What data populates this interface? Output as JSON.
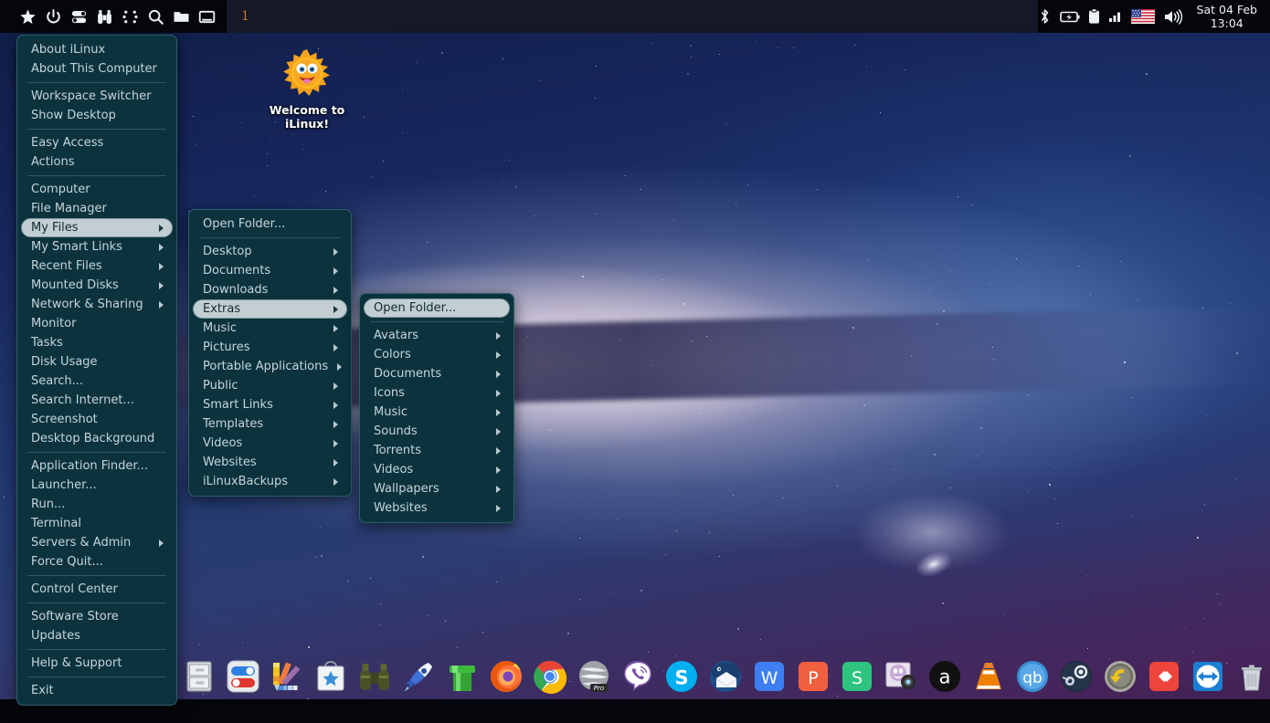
{
  "panel": {
    "launchers": [
      {
        "name": "favorites-star-icon",
        "label": "Favorites"
      },
      {
        "name": "power-icon",
        "label": "Power"
      },
      {
        "name": "toggles-icon",
        "label": "Settings Toggles"
      },
      {
        "name": "binoculars-icon",
        "label": "Find"
      },
      {
        "name": "app-grid-icon",
        "label": "Applications"
      },
      {
        "name": "search-icon",
        "label": "Search"
      },
      {
        "name": "folder-icon",
        "label": "File Manager"
      },
      {
        "name": "show-desktop-icon",
        "label": "Show Desktop"
      }
    ],
    "workspace": "1",
    "tray": [
      {
        "name": "bluetooth-icon",
        "label": "Bluetooth"
      },
      {
        "name": "battery-icon",
        "label": "Battery"
      },
      {
        "name": "clipboard-icon",
        "label": "Clipboard"
      },
      {
        "name": "signal-strength-icon",
        "label": "Signal"
      },
      {
        "name": "us-flag-icon",
        "label": "Keyboard Layout: US"
      },
      {
        "name": "volume-icon",
        "label": "Volume"
      }
    ],
    "clock": {
      "date": "Sat 04 Feb",
      "time": "13:04"
    }
  },
  "desktop": {
    "icon": {
      "name": "welcome-sun-icon",
      "line1": "Welcome to",
      "line2": "iLinux!"
    }
  },
  "menu_main": {
    "groups": [
      {
        "items": [
          {
            "label": "About iLinux",
            "submenu": false,
            "selected": false
          },
          {
            "label": "About This Computer",
            "submenu": false,
            "selected": false
          }
        ]
      },
      {
        "items": [
          {
            "label": "Workspace Switcher",
            "submenu": false,
            "selected": false
          },
          {
            "label": "Show Desktop",
            "submenu": false,
            "selected": false
          }
        ]
      },
      {
        "items": [
          {
            "label": "Easy Access",
            "submenu": false,
            "selected": false
          },
          {
            "label": "Actions",
            "submenu": false,
            "selected": false
          }
        ]
      },
      {
        "items": [
          {
            "label": "Computer",
            "submenu": false,
            "selected": false
          },
          {
            "label": "File Manager",
            "submenu": false,
            "selected": false
          },
          {
            "label": "My Files",
            "submenu": true,
            "selected": true
          },
          {
            "label": "My Smart Links",
            "submenu": true,
            "selected": false
          },
          {
            "label": "Recent Files",
            "submenu": true,
            "selected": false
          },
          {
            "label": "Mounted Disks",
            "submenu": true,
            "selected": false
          },
          {
            "label": "Network & Sharing",
            "submenu": true,
            "selected": false
          },
          {
            "label": "Monitor",
            "submenu": false,
            "selected": false
          },
          {
            "label": "Tasks",
            "submenu": false,
            "selected": false
          },
          {
            "label": "Disk Usage",
            "submenu": false,
            "selected": false
          },
          {
            "label": "Search...",
            "submenu": false,
            "selected": false
          },
          {
            "label": "Search Internet...",
            "submenu": false,
            "selected": false
          },
          {
            "label": "Screenshot",
            "submenu": false,
            "selected": false
          },
          {
            "label": "Desktop Background",
            "submenu": false,
            "selected": false
          }
        ]
      },
      {
        "items": [
          {
            "label": "Application Finder...",
            "submenu": false,
            "selected": false
          },
          {
            "label": "Launcher...",
            "submenu": false,
            "selected": false
          },
          {
            "label": "Run...",
            "submenu": false,
            "selected": false
          },
          {
            "label": "Terminal",
            "submenu": false,
            "selected": false
          },
          {
            "label": "Servers & Admin",
            "submenu": true,
            "selected": false
          },
          {
            "label": "Force Quit...",
            "submenu": false,
            "selected": false
          }
        ]
      },
      {
        "items": [
          {
            "label": "Control Center",
            "submenu": false,
            "selected": false
          }
        ]
      },
      {
        "items": [
          {
            "label": "Software Store",
            "submenu": false,
            "selected": false
          },
          {
            "label": "Updates",
            "submenu": false,
            "selected": false
          }
        ]
      },
      {
        "items": [
          {
            "label": "Help & Support",
            "submenu": false,
            "selected": false
          }
        ]
      },
      {
        "items": [
          {
            "label": "Exit",
            "submenu": false,
            "selected": false
          }
        ]
      }
    ]
  },
  "menu_my_files": {
    "groups": [
      {
        "items": [
          {
            "label": "Open Folder...",
            "submenu": false,
            "selected": false
          }
        ]
      },
      {
        "items": [
          {
            "label": "Desktop",
            "submenu": true,
            "selected": false
          },
          {
            "label": "Documents",
            "submenu": true,
            "selected": false
          },
          {
            "label": "Downloads",
            "submenu": true,
            "selected": false
          },
          {
            "label": "Extras",
            "submenu": true,
            "selected": true
          },
          {
            "label": "Music",
            "submenu": true,
            "selected": false
          },
          {
            "label": "Pictures",
            "submenu": true,
            "selected": false
          },
          {
            "label": "Portable Applications",
            "submenu": true,
            "selected": false
          },
          {
            "label": "Public",
            "submenu": true,
            "selected": false
          },
          {
            "label": "Smart Links",
            "submenu": true,
            "selected": false
          },
          {
            "label": "Templates",
            "submenu": true,
            "selected": false
          },
          {
            "label": "Videos",
            "submenu": true,
            "selected": false
          },
          {
            "label": "Websites",
            "submenu": true,
            "selected": false
          },
          {
            "label": "iLinuxBackups",
            "submenu": true,
            "selected": false
          }
        ]
      }
    ]
  },
  "menu_extras": {
    "groups": [
      {
        "items": [
          {
            "label": "Open Folder...",
            "submenu": false,
            "selected": true
          }
        ]
      },
      {
        "items": [
          {
            "label": "Avatars",
            "submenu": true,
            "selected": false
          },
          {
            "label": "Colors",
            "submenu": true,
            "selected": false
          },
          {
            "label": "Documents",
            "submenu": true,
            "selected": false
          },
          {
            "label": "Icons",
            "submenu": true,
            "selected": false
          },
          {
            "label": "Music",
            "submenu": true,
            "selected": false
          },
          {
            "label": "Sounds",
            "submenu": true,
            "selected": false
          },
          {
            "label": "Torrents",
            "submenu": true,
            "selected": false
          },
          {
            "label": "Videos",
            "submenu": true,
            "selected": false
          },
          {
            "label": "Wallpapers",
            "submenu": true,
            "selected": false
          },
          {
            "label": "Websites",
            "submenu": true,
            "selected": false
          }
        ]
      }
    ]
  },
  "dock": {
    "items": [
      {
        "name": "file-cabinet-icon",
        "label": "File Manager"
      },
      {
        "name": "toggles-icon",
        "label": "Settings"
      },
      {
        "name": "color-palette-icon",
        "label": "Theme Colors"
      },
      {
        "name": "software-store-icon",
        "label": "Software Store"
      },
      {
        "name": "binoculars-icon",
        "label": "Find Files"
      },
      {
        "name": "rocket-icon",
        "label": "Launcher"
      },
      {
        "name": "green-pipe-icon",
        "label": "Pipe"
      },
      {
        "name": "firefox-icon",
        "label": "Firefox"
      },
      {
        "name": "chrome-icon",
        "label": "Google Chrome"
      },
      {
        "name": "opera-pro-icon",
        "label": "Opera Pro"
      },
      {
        "name": "viber-icon",
        "label": "Viber"
      },
      {
        "name": "skype-icon",
        "label": "Skype"
      },
      {
        "name": "thunderbird-icon",
        "label": "Thunderbird"
      },
      {
        "name": "wps-writer-icon",
        "label": "WPS Writer"
      },
      {
        "name": "wps-presentation-icon",
        "label": "WPS Presentation"
      },
      {
        "name": "wps-spreadsheet-icon",
        "label": "WPS Spreadsheet"
      },
      {
        "name": "webcam-icon",
        "label": "Webcam"
      },
      {
        "name": "amazon-icon",
        "label": "Amazon"
      },
      {
        "name": "vlc-icon",
        "label": "VLC Media Player"
      },
      {
        "name": "qbittorrent-icon",
        "label": "qBittorrent"
      },
      {
        "name": "steam-icon",
        "label": "Steam"
      },
      {
        "name": "timeshift-icon",
        "label": "Timeshift"
      },
      {
        "name": "anydesk-icon",
        "label": "AnyDesk"
      },
      {
        "name": "teamviewer-icon",
        "label": "TeamViewer"
      },
      {
        "name": "trash-icon",
        "label": "Trash"
      }
    ]
  },
  "colors": {
    "menu_bg": "#0c333d",
    "menu_border": "#2b5f6b",
    "menu_text": "#c4d4da",
    "menu_selected_bg": "#c3ced2",
    "menu_selected_text": "#102b33",
    "panel_bg": "#05060b",
    "workspace_accent": "#c8751f"
  }
}
